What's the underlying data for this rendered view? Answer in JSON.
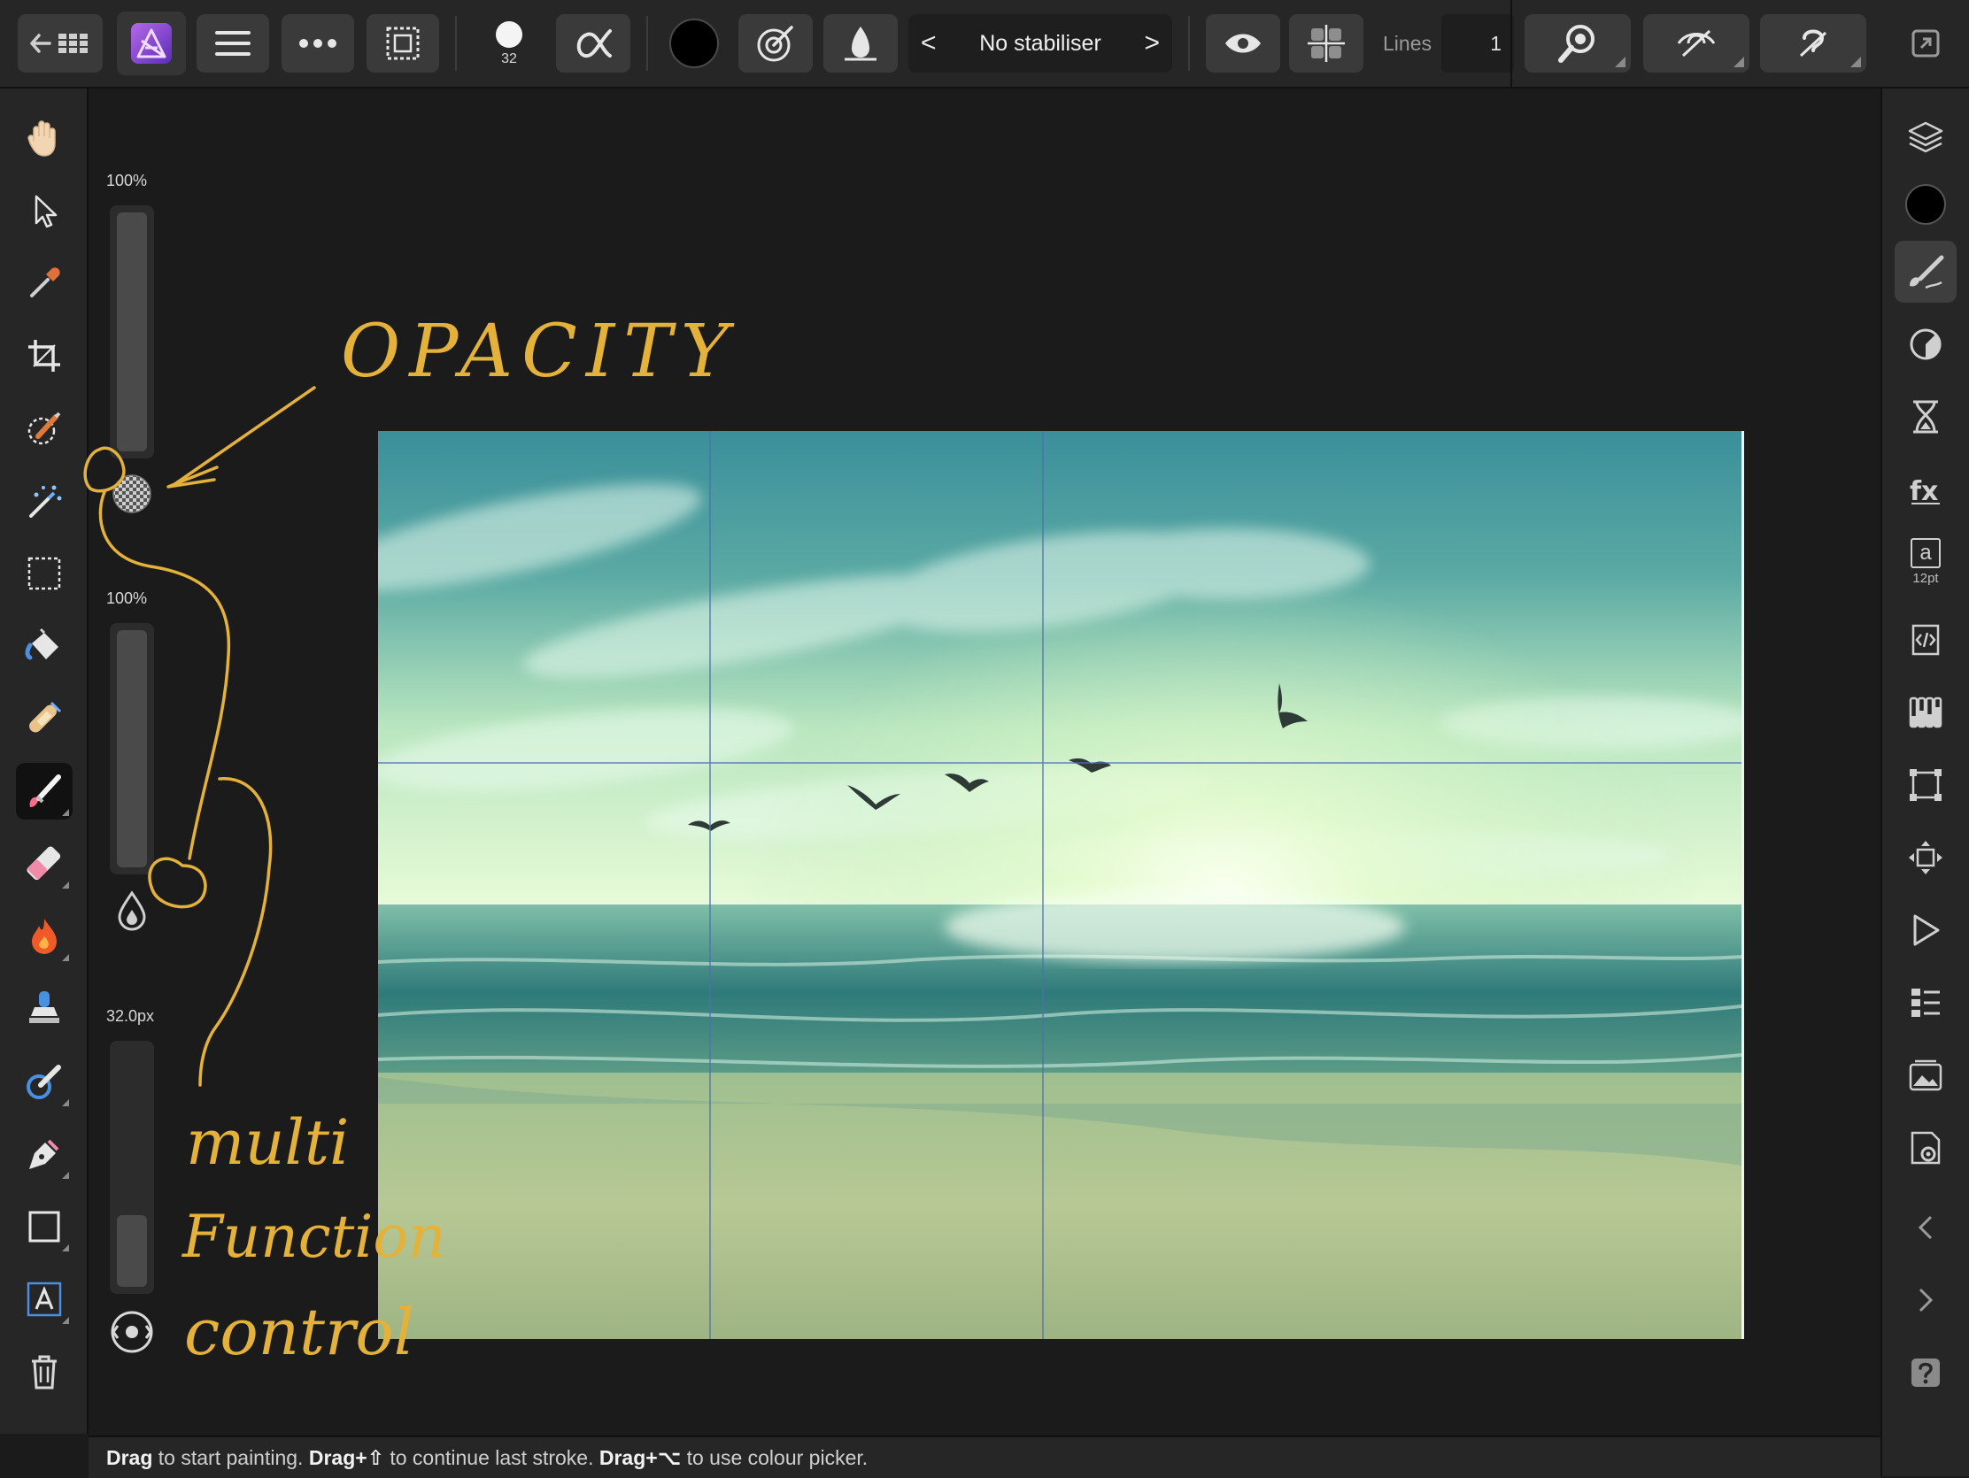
{
  "topbar": {
    "brush_size": "32",
    "stabiliser": "No stabiliser",
    "lines_label": "Lines",
    "lines_value": "1",
    "prev_label": "<",
    "next_label": ">"
  },
  "sliders": {
    "opacity_value": "100%",
    "flow_value": "100%",
    "width_value": "32.0px",
    "opacity_level": 1.0,
    "flow_level": 1.0,
    "width_level": 0.3
  },
  "right_panel": {
    "text_style_letter": "a",
    "text_style_size": "12pt",
    "primary_color": "#000000"
  },
  "annotations": {
    "opacity_note": "OPACITY",
    "multi_line1": "multi",
    "multi_line2": "Function",
    "multi_line3": "control",
    "annotation_color": "#e4b23a"
  },
  "status": {
    "drag1": "Drag",
    "text1": " to start painting. ",
    "drag2": "Drag+⇧",
    "text2": " to continue last stroke. ",
    "drag3": "Drag+⌥",
    "text3": " to use colour picker."
  },
  "icons": {
    "top": [
      "back-grid-icon",
      "affinity-photo-logo",
      "menu-icon",
      "more-icon",
      "selection-icon",
      "brush-size-icon",
      "alpha-icon",
      "color-swatch-icon",
      "wet-edges-icon",
      "ink-icon",
      "eye-icon",
      "symmetry-icon",
      "zoom-icon",
      "view-mode-icon",
      "assistant-icon",
      "fullscreen-icon"
    ],
    "left": [
      "hand-icon",
      "pointer-icon",
      "color-picker-icon",
      "crop-icon",
      "selection-brush-icon",
      "magic-wand-icon",
      "marquee-icon",
      "flood-fill-icon",
      "healing-brush-icon",
      "paint-brush-icon",
      "erase-brush-icon",
      "burn-icon",
      "clone-stamp-icon",
      "smudge-icon",
      "pen-icon",
      "rectangle-icon",
      "text-icon",
      "trash-icon"
    ],
    "right": [
      "layers-icon",
      "color-icon",
      "brushes-icon",
      "adjustments-icon",
      "history-icon",
      "fx-icon",
      "text-styles-icon",
      "source-icon",
      "channels-icon",
      "transform-icon",
      "navigator-icon",
      "play-icon",
      "stock-icon",
      "snapshots-icon",
      "settings-icon",
      "collapse-left-icon",
      "collapse-right-icon",
      "help-icon"
    ]
  }
}
